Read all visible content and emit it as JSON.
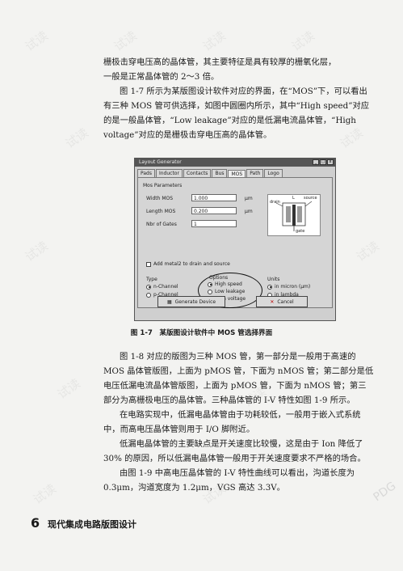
{
  "paragraphs": {
    "intro_line1": "栅极击穿电压高的晶体管，其主要特征是具有较厚的栅氧化层，",
    "intro_line2": "一般是正常晶体管的 2～3 倍。",
    "p2": "图 1-7 所示为某版图设计软件对应的界面，在“MOS”下，可以看出有三种 MOS 管可供选择，如图中圆圈内所示，其中“High speed”对应的是一般晶体管，“Low leakage”对应的是低漏电流晶体管，“High voltage”对应的是栅极击穿电压高的晶体管。",
    "p3": "图 1-8 对应的版图为三种 MOS 管，第一部分是一般用于高速的 MOS 晶体管版图，上面为 pMOS 管，下面为 nMOS 管；第二部分是低电压低漏电流晶体管版图，上面为 pMOS 管，下面为 nMOS 管；第三部分为高栅极电压的晶体管。三种晶体管的 I-V 特性如图 1-9 所示。",
    "p4": "在电路实现中，低漏电晶体管由于功耗较低，一般用于嵌入式系统中，而高电压晶体管则用于 I/O 脚附近。",
    "p5": "低漏电晶体管的主要缺点是开关速度比较慢，这是由于 Ion 降低了 30% 的原因，所以低漏电晶体管一般用于开关速度要求不严格的场合。",
    "p6": "由图 1-9 中高电压晶体管的 I-V 特性曲线可以看出，沟道长度为 0.3μm，沟道宽度为 1.2μm，VGS 高达 3.3V。"
  },
  "dialog": {
    "title": "Layout Generator",
    "tabs": [
      "Pads",
      "Inductor",
      "Contacts",
      "Bus",
      "MOS",
      "Path",
      "Logo"
    ],
    "section": "Mos Parameters",
    "width_label": "Width MOS",
    "width_value": "1.000",
    "length_label": "Length MOS",
    "length_value": "0.200",
    "gates_label": "Nbr of Gates",
    "gates_value": "1",
    "unit": "µm",
    "schem_L": "L",
    "schem_source": "source",
    "schem_drain": "drain",
    "schem_gate": "gate",
    "add_metal": "Add metal2 to drain and source",
    "type_label": "Type",
    "type_n": "n-Channel",
    "type_p": "p-Channel",
    "options_label": "Options",
    "opt_high_speed": "High speed",
    "opt_low_leakage": "Low leakage",
    "opt_high_voltage": "High voltage",
    "units_label": "Units",
    "unit_micron": "in micron (µm)",
    "unit_lambda": "in lambda",
    "generate_label": "Generate Device",
    "cancel_label": "Cancel"
  },
  "figure_caption": "图 1-7　某版图设计软件中 MOS 管选择界面",
  "footer": {
    "page_number": "6",
    "book_title": "现代集成电路版图设计"
  },
  "watermark_text": "试读",
  "stamp_text": "PDG"
}
